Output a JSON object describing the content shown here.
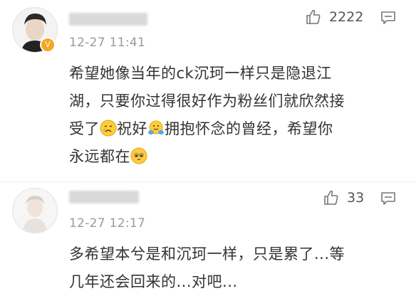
{
  "comments": [
    {
      "timestamp": "12-27 11:41",
      "likes": "2222",
      "verified": true,
      "lines": [
        "希望她像当年的ck沉珂一样只是隐退江",
        "湖，只要你过得很好作为粉丝们就欣然接",
        "受了",
        "祝好",
        "拥抱怀念的曾经，希望你",
        "永远都在"
      ]
    },
    {
      "timestamp": "12-27 12:17",
      "likes": "33",
      "verified": false,
      "lines": [
        "多希望本兮是和沉珂一样，只是累了...等",
        "几年还会回来的...对吧..."
      ]
    }
  ],
  "icons": {
    "like": "thumbs-up-icon",
    "reply": "comment-icon",
    "emoji_cry": "crying-face-icon",
    "emoji_hug": "hugging-face-icon",
    "emoji_plead": "pleading-face-icon"
  },
  "colors": {
    "text": "#333333",
    "meta": "#9a9a9a",
    "badge": "#f6a623"
  }
}
